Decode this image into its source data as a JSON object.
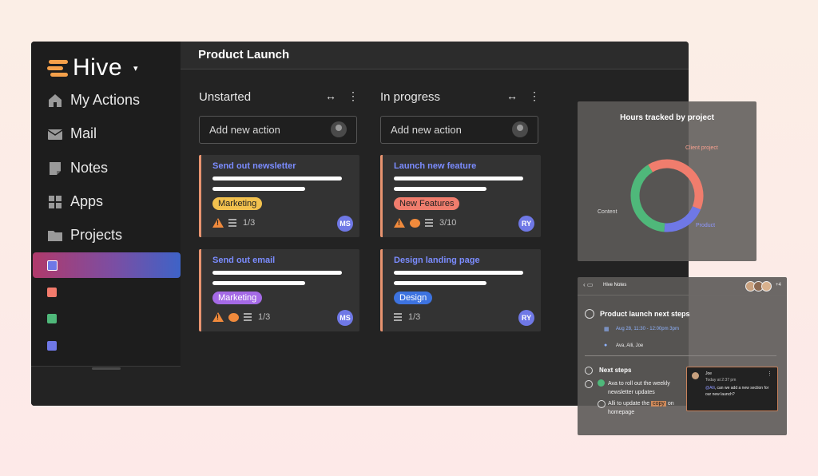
{
  "app": {
    "name": "Hive",
    "caret": "▾"
  },
  "sidebar": {
    "items": [
      {
        "label": "My Actions",
        "icon": "home-icon"
      },
      {
        "label": "Mail",
        "icon": "mail-icon"
      },
      {
        "label": "Notes",
        "icon": "note-icon"
      },
      {
        "label": "Apps",
        "icon": "grid-icon"
      },
      {
        "label": "Projects",
        "icon": "folder-icon"
      }
    ],
    "projects": [
      {
        "color": "#6f78e6",
        "active": true
      },
      {
        "color": "#f37b6c",
        "active": false
      },
      {
        "color": "#4fb87a",
        "active": false
      },
      {
        "color": "#6f78e6",
        "active": false
      }
    ]
  },
  "header": {
    "title": "Product Launch"
  },
  "board": {
    "columns": [
      {
        "title": "Unstarted",
        "expand_icon": "↔",
        "menu_icon": "⋮",
        "add_placeholder": "Add new action",
        "cards": [
          {
            "title": "Send out newsletter",
            "tag": "Marketing",
            "tag_color": "#f2c14e",
            "subtasks": "1/3",
            "assignee": "MS"
          },
          {
            "title": "Send out email",
            "tag": "Marketing",
            "tag_color": "#a56ae6",
            "subtasks": "1/3",
            "assignee": "MS"
          }
        ]
      },
      {
        "title": "In progress",
        "expand_icon": "↔",
        "menu_icon": "⋮",
        "add_placeholder": "Add new action",
        "cards": [
          {
            "title": "Launch new feature",
            "tag": "New Features",
            "tag_color": "#f07d6d",
            "subtasks": "3/10",
            "assignee": "RY"
          },
          {
            "title": "Design landing page",
            "tag": "Design",
            "tag_color": "#3d73e0",
            "subtasks": "1/3",
            "assignee": "RY"
          }
        ]
      }
    ]
  },
  "hours_widget": {
    "title": "Hours tracked by project",
    "labels": {
      "client": "Client project",
      "content": "Content",
      "product": "Product"
    }
  },
  "chart_data": {
    "type": "pie",
    "title": "Hours tracked by project",
    "series": [
      {
        "name": "Client project",
        "value": 0.4,
        "color": "#f07d6d"
      },
      {
        "name": "Product",
        "value": 0.2,
        "color": "#6f78e6"
      },
      {
        "name": "Content",
        "value": 0.4,
        "color": "#4fb87a"
      }
    ]
  },
  "notes": {
    "nav": "‹  ▭",
    "app_name": "Hive Notes",
    "avatar_extra": "+4",
    "heading": "Product launch next steps",
    "date": "Aug 28, 11:30 - 12:00pm 3pm",
    "people": "Ava, Alli, Joe",
    "next_steps": "Next steps",
    "task1_line1": "Ava to roll out the weekly",
    "task1_line2": "newsletter updates",
    "task2_pre": "Alli to update the",
    "task2_highlight": "copy",
    "task2_post": "on",
    "task2_line2": "homepage",
    "comment": {
      "name": "Joe",
      "time": "Today at 2:37 pm",
      "mention": "@Alli",
      "text": ", can we add a new section for our new launch?",
      "kebab": "⋮"
    }
  }
}
